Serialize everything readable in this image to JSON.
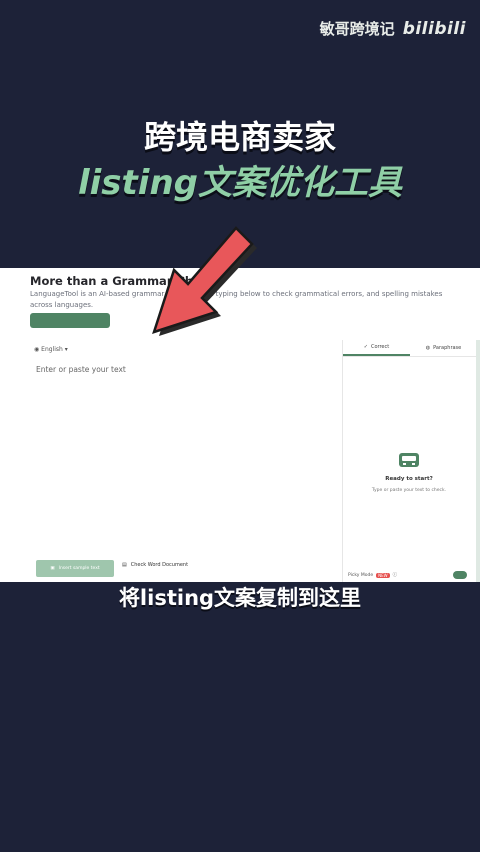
{
  "watermark": {
    "channel": "敏哥跨境记",
    "brand": "bilibili"
  },
  "headline": "跨境电商卖家",
  "subheadline": "listing文案优化工具",
  "app": {
    "title": "More than a Grammar Che",
    "description": "LanguageTool is an AI-based grammar   r text or start typing below to check grammatical errors, and spelling mistakes across languages.",
    "language": "English",
    "editor_placeholder": "Enter or paste your text",
    "panel_tabs": [
      "Correct",
      "Paraphrase"
    ],
    "ready_title": "Ready to start?",
    "ready_subtitle": "Type or paste your text to check.",
    "sample_button": "Insert sample text",
    "word_button": "Check Word Document",
    "picky_label": "Picky Mode",
    "picky_badge": "NEW"
  },
  "caption": "将listing文案复制到这里",
  "colors": {
    "accent": "#4f8464",
    "arrow": "#e8575a",
    "background": "#1d2238",
    "subheadline": "#8fcfa6"
  }
}
